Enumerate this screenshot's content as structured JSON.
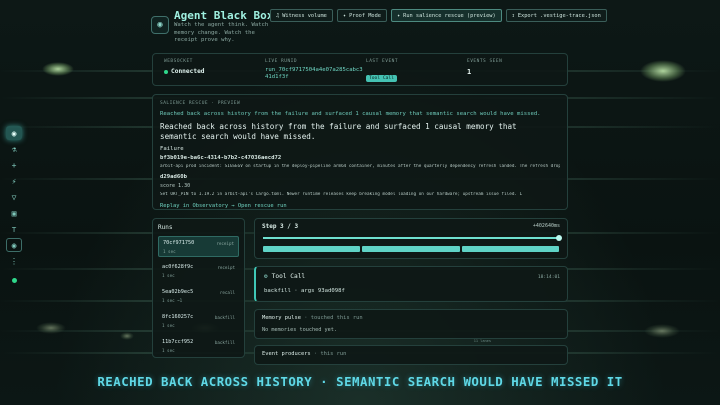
{
  "app": {
    "title": "Agent Black Box",
    "subtitle": "Watch the agent think. Watch memory change. Watch the receipt prove why.",
    "logo_icon": "camera-icon"
  },
  "toolbar": {
    "witness_label": "Witness volume",
    "proof_label": "Proof Mode",
    "rescue_label": "Run salience rescue (preview)",
    "export_label": "Export .vestige-trace.json"
  },
  "status": {
    "websocket_caption": "WEBSOCKET",
    "websocket_value": "Connected",
    "live_run_caption": "LIVE RUNID",
    "live_run_value": "run_70cf9717504a4e07a285cabc341d1f3f",
    "last_event_caption": "LAST EVENT",
    "last_event_value": "Tool Call",
    "events_caption": "EVENTS SEEN",
    "events_value": "1"
  },
  "salience": {
    "caption": "SALIENCE RESCUE · PREVIEW",
    "headline": "Reached back across history from the failure and surfaced 1 causal memory that semantic search would have missed.",
    "title": "Reached back across history from the failure and surfaced 1 causal memory that semantic search would have missed.",
    "failure_label": "Failure",
    "failure_id": "bf3b019e-ba6c-4314-b7b2-c47036aecd72",
    "failure_text": "arbit-api prod incident: SIGSEGV on startup in the deploy-pipeline arm64 container, minutes after the quarterly dependency refresh landed. The refresh dropped 0",
    "memory_id": "d29ad60b",
    "score": "score 1.30",
    "memory_text": "Set ORT_PIN to 1.19.2 in arbit-api's Cargo.toml. Newer runtime releases keep breaking model loading on our hardware; upstream issue filed. L",
    "replay_link": "Replay in Observatory → Open rescue run"
  },
  "runs": {
    "title": "Runs",
    "items": [
      {
        "id": "70cf971750",
        "age": "1 sec",
        "kind": "receipt"
      },
      {
        "id": "ac0f628f9c",
        "age": "1 sec",
        "kind": "receipt"
      },
      {
        "id": "5ea02b9ec5",
        "age": "1 sec ~1",
        "kind": "recall"
      },
      {
        "id": "8fc160257c",
        "age": "1 sec",
        "kind": "backfill"
      },
      {
        "id": "11b7ccf952",
        "age": "1 sec",
        "kind": "backfill"
      }
    ]
  },
  "step": {
    "label": "Step 3 / 3",
    "timestamp": "+402640ms",
    "progress": 1.0,
    "segments": 3
  },
  "tool_call": {
    "title": "Tool Call",
    "time": "18:14:01",
    "args": "backfill · args 93ad098f"
  },
  "memory_pulse": {
    "title": "Memory pulse",
    "subtitle": "touched this run",
    "empty": "No memories touched yet.",
    "hint": "11 lanes"
  },
  "producers": {
    "title": "Event producers",
    "subtitle": "this run"
  },
  "banner": "REACHED BACK ACROSS HISTORY · SEMANTIC SEARCH WOULD HAVE MISSED IT",
  "colors": {
    "accent": "#5fd3c6",
    "connected": "#2fd88b",
    "banner": "#5fd8e6"
  }
}
